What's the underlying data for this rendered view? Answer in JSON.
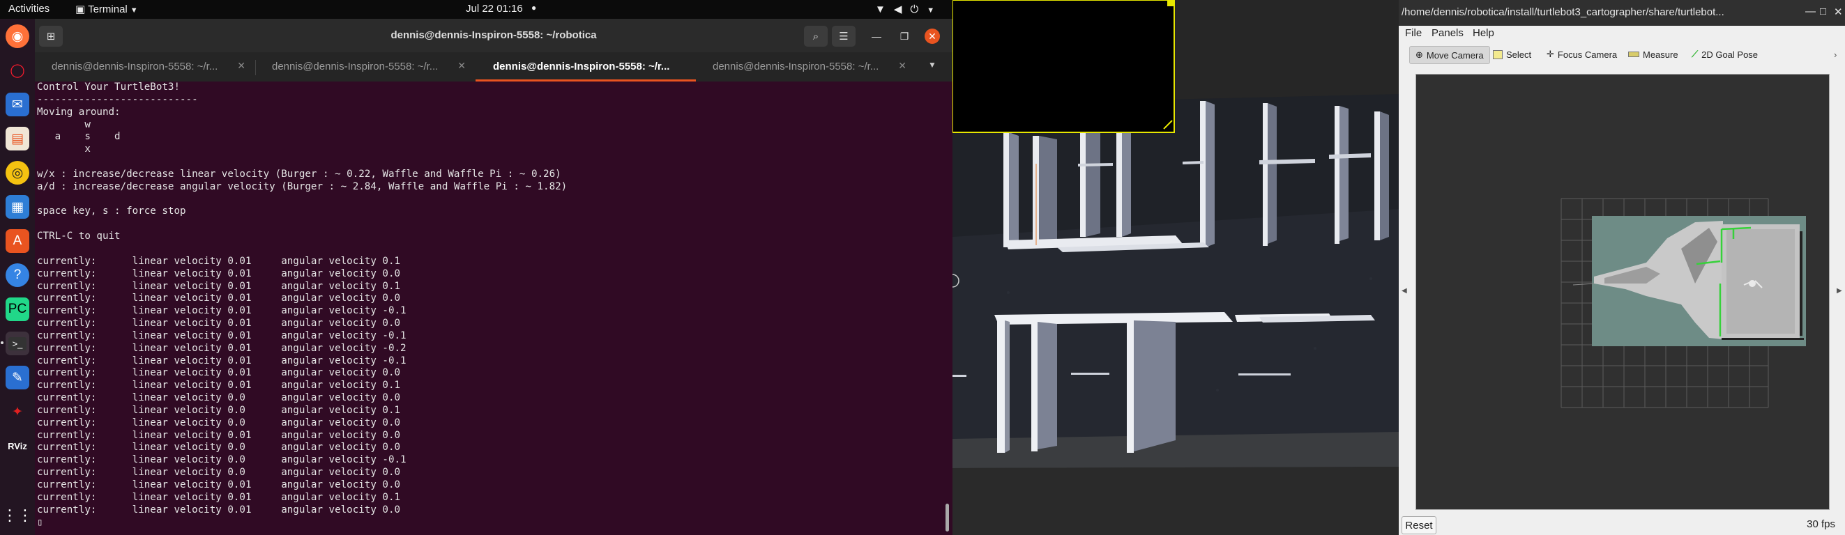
{
  "topbar": {
    "activities": "Activities",
    "app_menu": "Terminal",
    "clock": "Jul 22  01:16",
    "tray_icons": [
      "wifi-icon",
      "volume-icon",
      "power-icon",
      "menu-arrow-icon"
    ]
  },
  "dock": {
    "items": [
      "firefox-icon",
      "opera-icon",
      "thunderbird-icon",
      "files-icon",
      "rhythmbox-icon",
      "writer-icon",
      "software-icon",
      "help-icon",
      "pycharm-icon",
      "terminal-icon",
      "text-editor-icon",
      "gazebo-icon",
      "rviz-icon",
      "app-grid-icon"
    ],
    "rviz_label": "RViz"
  },
  "terminal": {
    "title": "dennis@dennis-Inspiron-5558: ~/robotica",
    "tabs": [
      {
        "label": "dennis@dennis-Inspiron-5558: ~/r..."
      },
      {
        "label": "dennis@dennis-Inspiron-5558: ~/r..."
      },
      {
        "label": "dennis@dennis-Inspiron-5558: ~/r...",
        "active": true
      },
      {
        "label": "dennis@dennis-Inspiron-5558: ~/r..."
      }
    ],
    "lines": [
      "Control Your TurtleBot3!",
      "---------------------------",
      "Moving around:",
      "        w",
      "   a    s    d",
      "        x",
      "",
      "w/x : increase/decrease linear velocity (Burger : ~ 0.22, Waffle and Waffle Pi : ~ 0.26)",
      "a/d : increase/decrease angular velocity (Burger : ~ 2.84, Waffle and Waffle Pi : ~ 1.82)",
      "",
      "space key, s : force stop",
      "",
      "CTRL-C to quit",
      "",
      "currently:      linear velocity 0.01     angular velocity 0.1",
      "currently:      linear velocity 0.01     angular velocity 0.0",
      "currently:      linear velocity 0.01     angular velocity 0.1",
      "currently:      linear velocity 0.01     angular velocity 0.0",
      "currently:      linear velocity 0.01     angular velocity -0.1",
      "currently:      linear velocity 0.01     angular velocity 0.0",
      "currently:      linear velocity 0.01     angular velocity -0.1",
      "currently:      linear velocity 0.01     angular velocity -0.2",
      "currently:      linear velocity 0.01     angular velocity -0.1",
      "currently:      linear velocity 0.01     angular velocity 0.0",
      "currently:      linear velocity 0.01     angular velocity 0.1",
      "currently:      linear velocity 0.0      angular velocity 0.0",
      "currently:      linear velocity 0.0      angular velocity 0.1",
      "currently:      linear velocity 0.0      angular velocity 0.0",
      "currently:      linear velocity 0.01     angular velocity 0.0",
      "currently:      linear velocity 0.0      angular velocity 0.0",
      "currently:      linear velocity 0.0      angular velocity -0.1",
      "currently:      linear velocity 0.0      angular velocity 0.0",
      "currently:      linear velocity 0.01     angular velocity 0.0",
      "currently:      linear velocity 0.01     angular velocity 0.1",
      "currently:      linear velocity 0.01     angular velocity 0.0"
    ],
    "cursor": "▯"
  },
  "rviz": {
    "title": "/home/dennis/robotica/install/turtlebot3_cartographer/share/turtlebot...",
    "menu": {
      "file": "File",
      "panels": "Panels",
      "help": "Help"
    },
    "tools": {
      "move_camera": "Move Camera",
      "select": "Select",
      "focus_camera": "Focus Camera",
      "measure": "Measure",
      "goal_pose": "2D Goal Pose"
    },
    "reset": "Reset",
    "fps": "30 fps"
  },
  "colors": {
    "terminal_bg": "#300a24",
    "tab_accent": "#e95420",
    "close_button": "#e95420",
    "map_free": "#bdbdbd",
    "map_unknown": "#6e8c86",
    "map_walls": "#36d13a"
  }
}
